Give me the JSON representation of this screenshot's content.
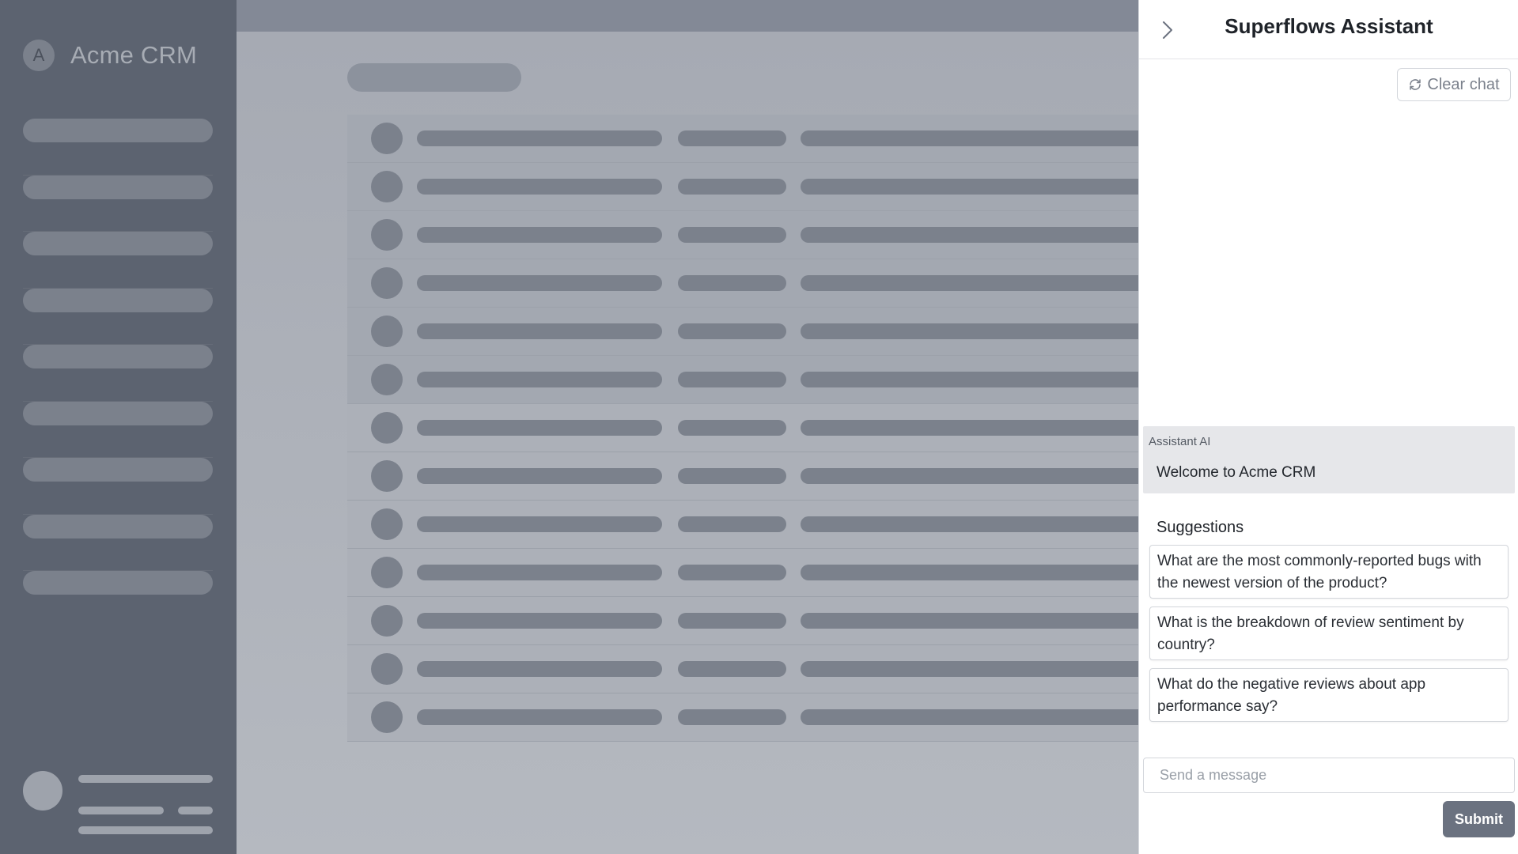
{
  "app": {
    "brand_initial": "A",
    "brand_name": "Acme CRM"
  },
  "assistant": {
    "title": "Superflows Assistant",
    "collapse_icon": "chevron-right-icon",
    "clear_chat_label": "Clear chat",
    "clear_chat_icon": "refresh-icon",
    "message": {
      "sender": "Assistant AI",
      "text": "Welcome to Acme CRM"
    },
    "suggestions_title": "Suggestions",
    "suggestions": [
      "What are the most commonly-reported bugs with the newest version of the product?",
      "What is the breakdown of review sentiment by country?",
      "What do the negative reviews about app performance say?"
    ],
    "input_placeholder": "Send a message",
    "submit_label": "Submit"
  },
  "colors": {
    "overlay_sidebar": "#5c6370",
    "placeholder_bar": "#7b818c",
    "submit_button": "#6b7280"
  }
}
